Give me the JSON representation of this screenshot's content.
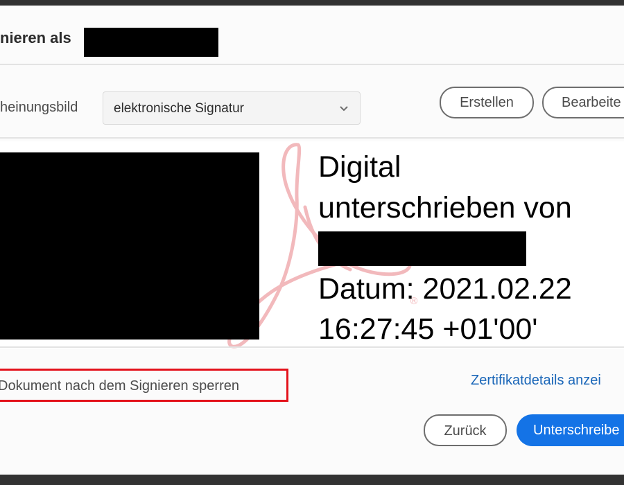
{
  "dialog": {
    "title": "nieren als",
    "appearance": {
      "label": "heinungsbild",
      "selected": "elektronische Signatur"
    },
    "buttons": {
      "create": "Erstellen",
      "edit": "Bearbeite",
      "back": "Zurück",
      "sign": "Unterschreibe"
    },
    "preview": {
      "line1": "Digital",
      "line2": "unterschrieben von",
      "line3": "Datum: 2021.02.22",
      "line4": "16:27:45 +01'00'"
    },
    "lock_checkbox_label": "Dokument nach dem Signieren sperren",
    "certificate_link": "Zertifikatdetails anzei"
  },
  "colors": {
    "accent": "#1473e6",
    "highlight": "#e3121b",
    "link": "#1a66b8",
    "watermark": "#f2b9bc"
  },
  "icons": {
    "dropdown": "chevron-down-icon",
    "watermark": "acrobat-logo-icon"
  }
}
